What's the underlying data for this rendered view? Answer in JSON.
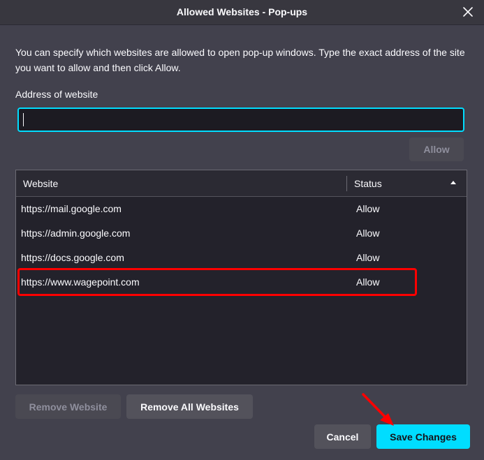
{
  "window": {
    "title": "Allowed Websites - Pop-ups"
  },
  "intro_text": "You can specify which websites are allowed to open pop-up windows. Type the exact address of the site you want to allow and then click Allow.",
  "address": {
    "label": "Address of website",
    "value": "",
    "placeholder": ""
  },
  "buttons": {
    "allow": "Allow",
    "remove_website": "Remove Website",
    "remove_all": "Remove All Websites",
    "cancel": "Cancel",
    "save": "Save Changes"
  },
  "table": {
    "headers": {
      "website": "Website",
      "status": "Status"
    },
    "sort": "status-ascending",
    "rows": [
      {
        "site": "https://mail.google.com",
        "status": "Allow"
      },
      {
        "site": "https://admin.google.com",
        "status": "Allow"
      },
      {
        "site": "https://docs.google.com",
        "status": "Allow"
      },
      {
        "site": "https://www.wagepoint.com",
        "status": "Allow"
      }
    ]
  },
  "colors": {
    "accent": "#00ddff",
    "annotation": "#ff0000",
    "background": "#42414d",
    "list_background": "#23222b"
  },
  "icons": {
    "close": "close-icon",
    "sort": "sort-ascending-icon",
    "annotation_arrow": "red-arrow-icon"
  }
}
